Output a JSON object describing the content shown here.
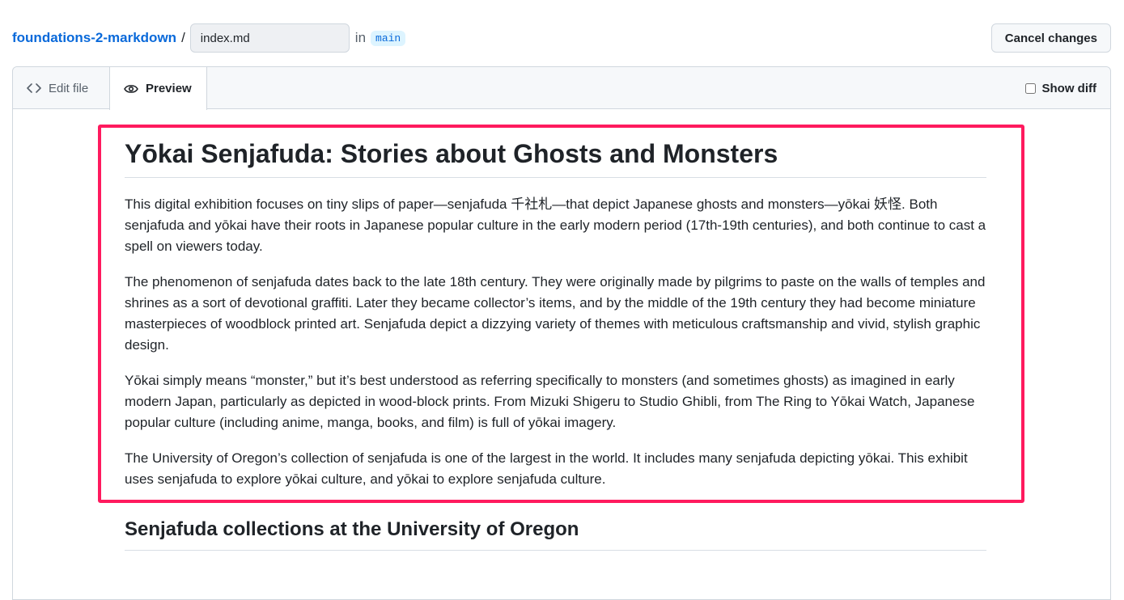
{
  "header": {
    "repo_name": "foundations-2-markdown",
    "separator": "/",
    "filename_value": "index.md",
    "in_label": "in",
    "branch": "main",
    "cancel_label": "Cancel changes"
  },
  "tabs": {
    "edit_label": "Edit file",
    "preview_label": "Preview",
    "show_diff_label": "Show diff",
    "show_diff_checked": false
  },
  "preview": {
    "title": "Yōkai Senjafuda: Stories about Ghosts and Monsters",
    "paragraphs": [
      "This digital exhibition focuses on tiny slips of paper—senjafuda 千社札—that depict Japanese ghosts and monsters—yōkai 妖怪. Both senjafuda and yōkai have their roots in Japanese popular culture in the early modern period (17th-19th centuries), and both continue to cast a spell on viewers today.",
      "The phenomenon of senjafuda dates back to the late 18th century. They were originally made by pilgrims to paste on the walls of temples and shrines as a sort of devotional graffiti. Later they became collector’s items, and by the middle of the 19th century they had become miniature masterpieces of woodblock printed art. Senjafuda depict a dizzying variety of themes with meticulous craftsmanship and vivid, stylish graphic design.",
      "Yōkai simply means “monster,” but it’s best understood as referring specifically to monsters (and sometimes ghosts) as imagined in early modern Japan, particularly as depicted in wood-block prints. From Mizuki Shigeru to Studio Ghibli, from The Ring to Yōkai Watch, Japanese popular culture (including anime, manga, books, and film) is full of yōkai imagery.",
      "The University of Oregon’s collection of senjafuda is one of the largest in the world. It includes many senjafuda depicting yōkai. This exhibit uses senjafuda to explore yōkai culture, and yōkai to explore senjafuda culture."
    ],
    "subheading": "Senjafuda collections at the University of Oregon"
  },
  "colors": {
    "highlight": "#ff1a5e",
    "link": "#0969da"
  }
}
